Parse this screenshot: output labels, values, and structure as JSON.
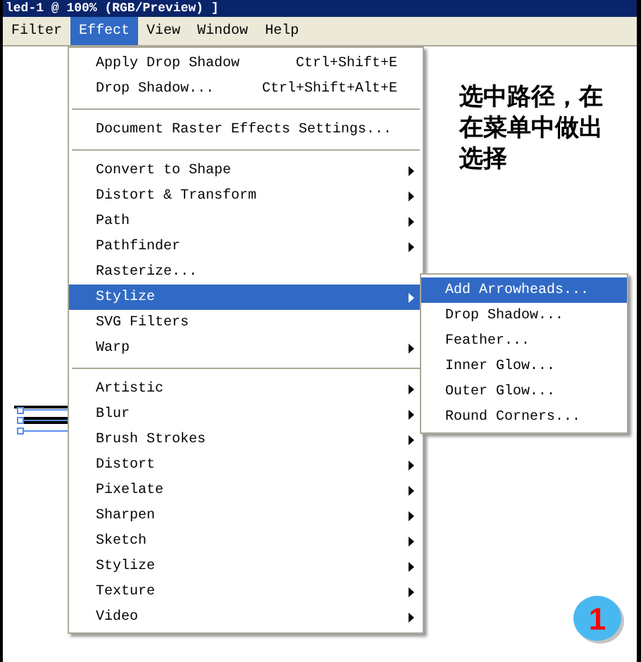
{
  "window": {
    "title": "led-1 @ 100% (RGB/Preview) ]"
  },
  "menu_bar": [
    {
      "label": "Filter",
      "selected": false
    },
    {
      "label": "Effect",
      "selected": true
    },
    {
      "label": "View",
      "selected": false
    },
    {
      "label": "Window",
      "selected": false
    },
    {
      "label": "Help",
      "selected": false
    }
  ],
  "effect_menu": {
    "groups": [
      [
        {
          "label": "Apply Drop Shadow",
          "shortcut": "Ctrl+Shift+E",
          "submenu": false,
          "selected": false
        },
        {
          "label": "Drop Shadow...",
          "shortcut": "Ctrl+Shift+Alt+E",
          "submenu": false,
          "selected": false
        }
      ],
      [
        {
          "label": "Document Raster Effects Settings...",
          "submenu": false,
          "selected": false
        }
      ],
      [
        {
          "label": "Convert to Shape",
          "submenu": true,
          "selected": false
        },
        {
          "label": "Distort & Transform",
          "submenu": true,
          "selected": false
        },
        {
          "label": "Path",
          "submenu": true,
          "selected": false
        },
        {
          "label": "Pathfinder",
          "submenu": true,
          "selected": false
        },
        {
          "label": "Rasterize...",
          "submenu": false,
          "selected": false
        },
        {
          "label": "Stylize",
          "submenu": true,
          "selected": true
        },
        {
          "label": "SVG Filters",
          "submenu": false,
          "selected": false
        },
        {
          "label": "Warp",
          "submenu": true,
          "selected": false
        }
      ],
      [
        {
          "label": "Artistic",
          "submenu": true,
          "selected": false
        },
        {
          "label": "Blur",
          "submenu": true,
          "selected": false
        },
        {
          "label": "Brush Strokes",
          "submenu": true,
          "selected": false
        },
        {
          "label": "Distort",
          "submenu": true,
          "selected": false
        },
        {
          "label": "Pixelate",
          "submenu": true,
          "selected": false
        },
        {
          "label": "Sharpen",
          "submenu": true,
          "selected": false
        },
        {
          "label": "Sketch",
          "submenu": true,
          "selected": false
        },
        {
          "label": "Stylize",
          "submenu": true,
          "selected": false
        },
        {
          "label": "Texture",
          "submenu": true,
          "selected": false
        },
        {
          "label": "Video",
          "submenu": true,
          "selected": false
        }
      ]
    ]
  },
  "stylize_submenu": [
    {
      "label": "Add Arrowheads...",
      "selected": true
    },
    {
      "label": "Drop Shadow...",
      "selected": false
    },
    {
      "label": "Feather...",
      "selected": false
    },
    {
      "label": "Inner Glow...",
      "selected": false
    },
    {
      "label": "Outer Glow...",
      "selected": false
    },
    {
      "label": "Round Corners...",
      "selected": false
    }
  ],
  "annotation": "选中路径，在在菜单中做出选择",
  "step_badge": "1"
}
